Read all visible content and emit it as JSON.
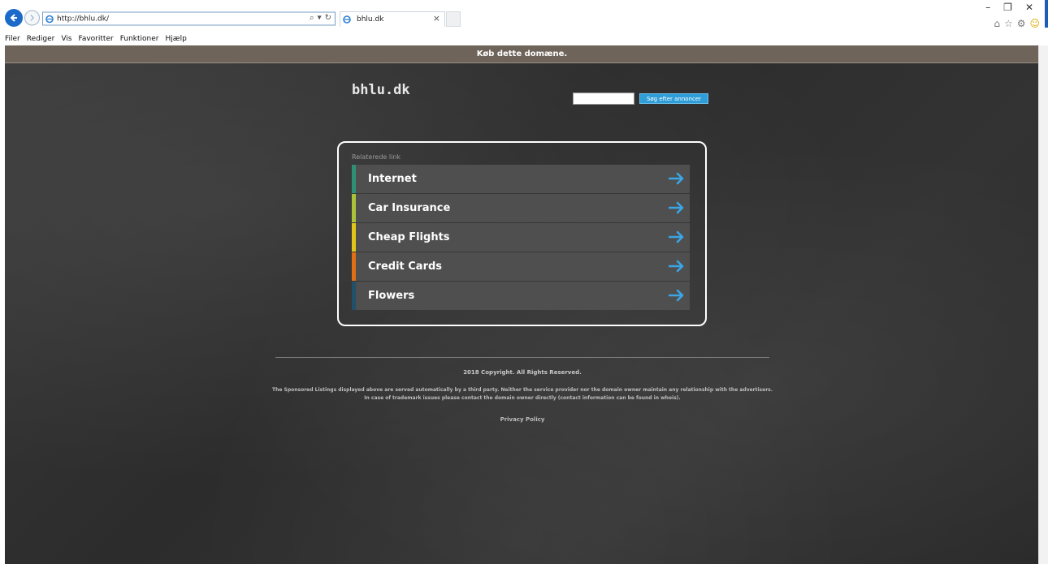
{
  "browser": {
    "address": "http://bhlu.dk/",
    "tab_title": "bhlu.dk",
    "tab_close": "×",
    "address_tools": [
      "⌕",
      "▾",
      "↻"
    ],
    "menu": [
      "Filer",
      "Rediger",
      "Vis",
      "Favoritter",
      "Funktioner",
      "Hjælp"
    ],
    "window_controls": [
      "–",
      "❐",
      "✕"
    ],
    "toolbar_icons": [
      "⌂",
      "☆",
      "⚙",
      "☺"
    ]
  },
  "page": {
    "buy_banner": "Køb dette domæne.",
    "site_title": "bhlu.dk",
    "search": {
      "placeholder": "",
      "button_label": "Søg efter annoncer"
    },
    "related_title": "Relaterede link",
    "links": [
      {
        "label": "Internet",
        "color": "#2e8f74"
      },
      {
        "label": "Car Insurance",
        "color": "#a9c23a"
      },
      {
        "label": "Cheap Flights",
        "color": "#e2c51a"
      },
      {
        "label": "Credit Cards",
        "color": "#e06f16"
      },
      {
        "label": "Flowers",
        "color": "#21506a"
      }
    ],
    "arrow_color": "#3aa6e6",
    "copyright": "2018 Copyright. All Rights Reserved.",
    "disclaimer": "The Sponsored Listings displayed above are served automatically by a third party. Neither the service provider nor the domain owner maintain any relationship with the advertisers. In case of trademark issues please contact the domain owner directly (contact information can be found in whois).",
    "privacy": "Privacy Policy"
  }
}
